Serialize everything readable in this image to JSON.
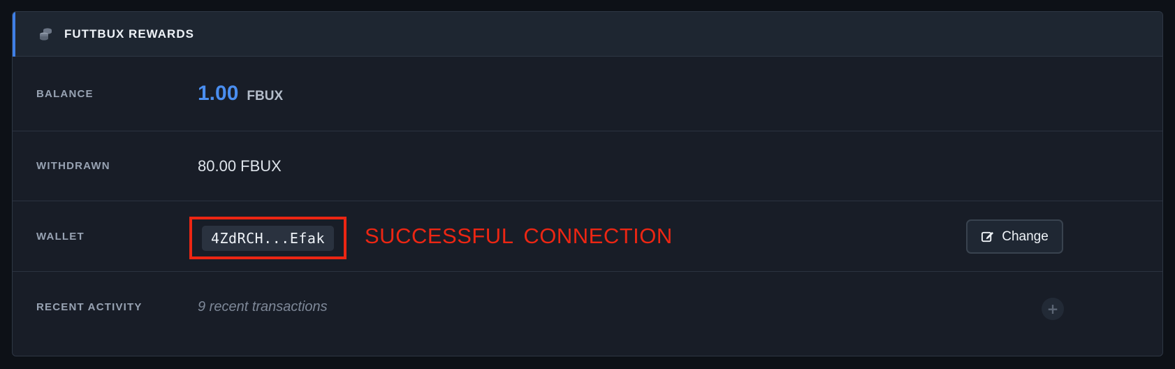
{
  "header": {
    "title": "FUTTBUX REWARDS",
    "icon": "coins-icon",
    "accent_color": "#3f7fe6"
  },
  "balance": {
    "label": "BALANCE",
    "amount": "1.00",
    "unit": "FBUX",
    "amount_color": "#4a8ef0"
  },
  "withdrawn": {
    "label": "WITHDRAWN",
    "value": "80.00 FBUX"
  },
  "wallet": {
    "label": "WALLET",
    "address": "4ZdRCH...Efak",
    "annotation": "SUCCESSFUL  CONNECTION",
    "annotation_color": "#ec2613",
    "change_label": "Change",
    "change_icon": "edit-icon"
  },
  "recent_activity": {
    "label": "RECENT ACTIVITY",
    "summary": "9 recent transactions",
    "expand_icon": "plus-icon",
    "expand_glyph": "+"
  }
}
